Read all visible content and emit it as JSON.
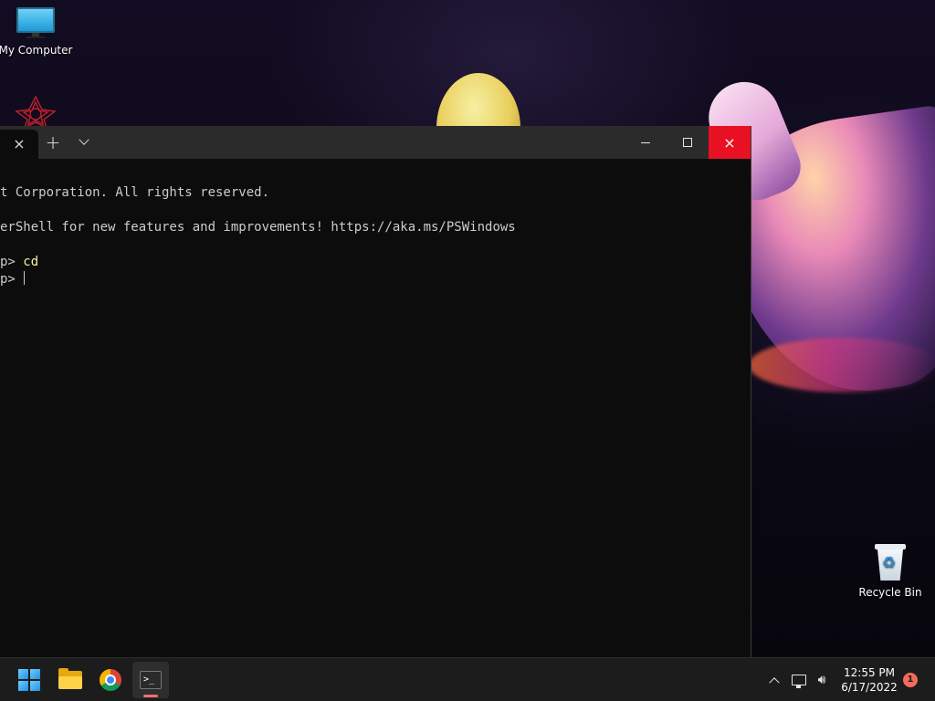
{
  "desktop": {
    "icons": [
      {
        "label": "My Computer",
        "icon": "monitor-icon"
      },
      {
        "label": "",
        "icon": "app-icon"
      },
      {
        "label": "Recycle Bin",
        "icon": "recycle-bin-icon"
      }
    ]
  },
  "terminal": {
    "tab": {
      "close_icon": "×"
    },
    "titlebar": {
      "new_tab_icon": "+",
      "minimize_icon": "minimize-icon",
      "maximize_icon": "maximize-icon",
      "close_icon": "×"
    },
    "lines": [
      "t Corporation. All rights reserved.",
      "",
      "erShell for new features and improvements! https://aka.ms/PSWindows",
      "",
      "p> ",
      "p> "
    ],
    "commands": [
      "cd",
      ""
    ]
  },
  "taskbar": {
    "apps": [
      {
        "name": "Start",
        "icon": "windows-start-icon"
      },
      {
        "name": "File Explorer",
        "icon": "folder-icon"
      },
      {
        "name": "Google Chrome",
        "icon": "chrome-icon"
      },
      {
        "name": "Terminal",
        "icon": "terminal-icon",
        "active": true
      }
    ],
    "tray": {
      "time": "12:55 PM",
      "date": "6/17/2022",
      "notification_count": "1"
    }
  },
  "colors": {
    "close_button": "#e81123",
    "command_text": "#f9f1a5",
    "console_bg": "#0c0c0c"
  }
}
